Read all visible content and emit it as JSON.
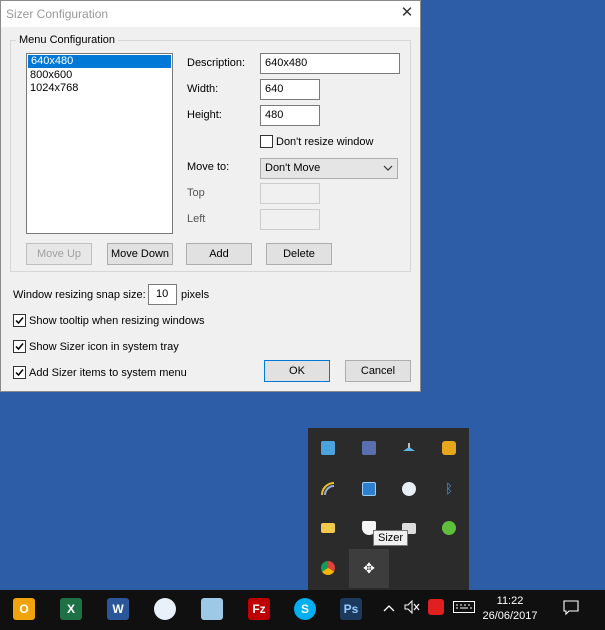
{
  "dialog": {
    "title": "Sizer Configuration",
    "group_label": "Menu Configuration",
    "list_items": [
      "640x480",
      "800x600",
      "1024x768"
    ],
    "selected_index": 0,
    "description_label": "Description:",
    "description_value": "640x480",
    "width_label": "Width:",
    "width_value": "640",
    "height_label": "Height:",
    "height_value": "480",
    "dont_resize_label": "Don't resize window",
    "dont_resize_checked": false,
    "move_to_label": "Move to:",
    "move_to_value": "Don't Move",
    "top_label": "Top",
    "left_label": "Left",
    "move_up": "Move Up",
    "move_down": "Move Down",
    "add": "Add",
    "delete": "Delete",
    "snap_label": "Window resizing snap size:",
    "snap_value": "10",
    "snap_unit": "pixels",
    "tooltip_label": "Show tooltip when resizing windows",
    "tooltip_checked": true,
    "tray_label": "Show Sizer icon in system tray",
    "tray_checked": true,
    "menu_label": "Add Sizer items to system menu",
    "menu_checked": true,
    "ok": "OK",
    "cancel": "Cancel"
  },
  "tray_popup": {
    "tooltip": "Sizer",
    "icons": [
      "network-card-icon",
      "notes-icon",
      "satellite-icon",
      "notification-icon",
      "wifi-icon",
      "display-icon",
      "usb-icon",
      "bluetooth-icon",
      "mail-icon",
      "security-icon",
      "printer-icon",
      "evernote-icon",
      "chrome-icon",
      "sizer-move-icon"
    ]
  },
  "taskbar": {
    "apps": [
      "Outlook",
      "Excel",
      "Word",
      "Skype for Business",
      "Pencil",
      "FileZilla",
      "Skype",
      "Photoshop"
    ],
    "app_badges": [
      "O",
      "X",
      "W",
      "",
      "",
      "Fz",
      "S",
      "Ps"
    ],
    "time": "11:22",
    "date": "26/06/2017",
    "colors": {
      "accent": "#0078d7",
      "taskbar": "#101010",
      "desktop": "#2d5da6"
    }
  }
}
